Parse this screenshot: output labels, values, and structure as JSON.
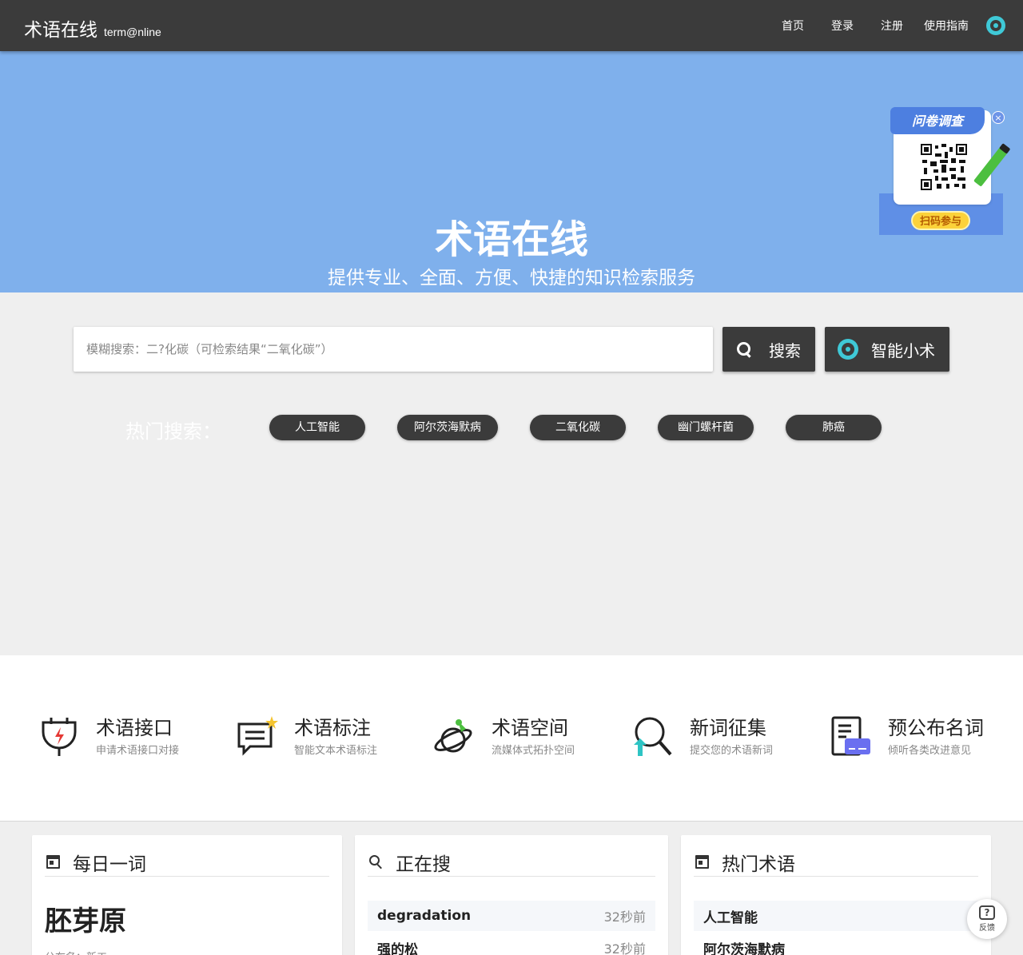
{
  "header": {
    "logo_cn": "术语在线",
    "logo_en": "term@nline",
    "nav": [
      "首页",
      "登录",
      "注册",
      "使用指南"
    ]
  },
  "hero": {
    "title": "术语在线",
    "subtitle": "提供专业、全面、方便、快捷的知识检索服务"
  },
  "survey": {
    "title": "问卷调查",
    "button": "扫码参与",
    "close": "×"
  },
  "search": {
    "placeholder": "模糊搜索：二?化碳（可检索结果“二氧化碳”）",
    "value": "",
    "search_button": "搜索",
    "smart_button": "智能小术"
  },
  "hot": {
    "label": "热门搜索：",
    "tags": [
      "人工智能",
      "阿尔茨海默病",
      "二氧化碳",
      "幽门螺杆菌",
      "肺癌"
    ]
  },
  "features": [
    {
      "title": "术语接口",
      "desc": "申请术语接口对接",
      "icon": "plug-icon"
    },
    {
      "title": "术语标注",
      "desc": "智能文本术语标注",
      "icon": "chat-star-icon"
    },
    {
      "title": "术语空间",
      "desc": "流媒体式拓扑空间",
      "icon": "planet-icon"
    },
    {
      "title": "新词征集",
      "desc": "提交您的术语新词",
      "icon": "magnifier-upload-icon"
    },
    {
      "title": "预公布名词",
      "desc": "倾听各类改进意见",
      "icon": "document-icon"
    }
  ],
  "panels": {
    "daily": {
      "title": "每日一词",
      "word": "胚芽原",
      "sub": "公布名：新工"
    },
    "searching": {
      "title": "正在搜",
      "items": [
        {
          "term": "degradation",
          "time": "32秒前"
        },
        {
          "term": "强的松",
          "time": "32秒前"
        }
      ]
    },
    "hot_terms": {
      "title": "热门术语",
      "items": [
        "人工智能",
        "阿尔茨海默病"
      ]
    }
  },
  "feedback": {
    "label": "反馈"
  },
  "colors": {
    "header": "#3b3b3b",
    "hero": "#7fb0ec",
    "accent": "#3fc9d7",
    "page_bg": "#efefef"
  }
}
